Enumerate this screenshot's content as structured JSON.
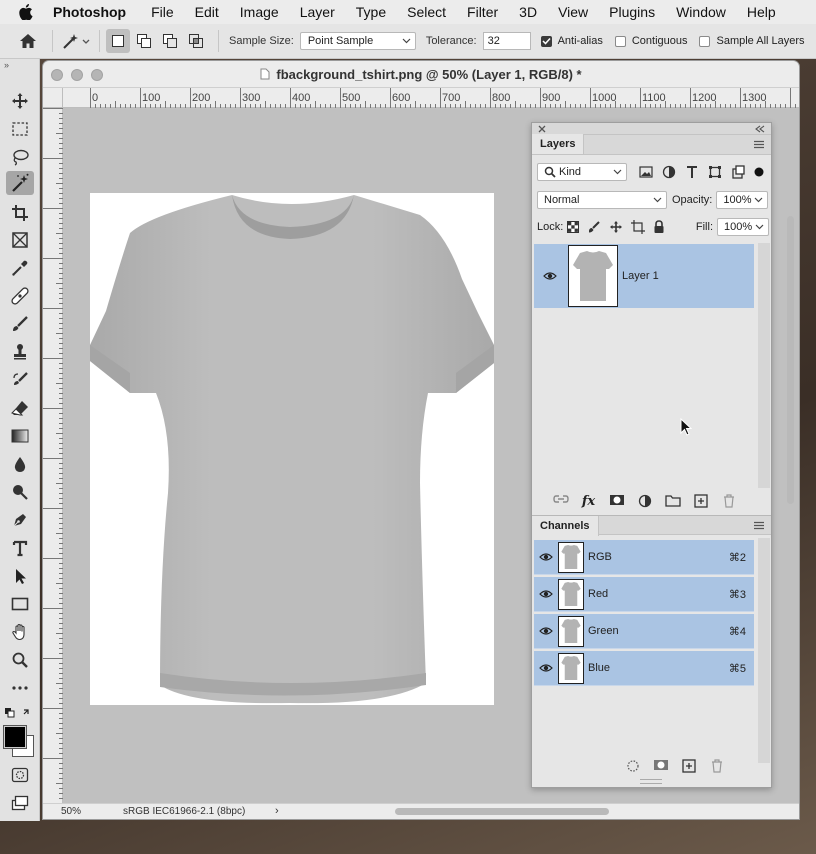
{
  "menubar": {
    "app_name": "Photoshop",
    "items": [
      "File",
      "Edit",
      "Image",
      "Layer",
      "Type",
      "Select",
      "Filter",
      "3D",
      "View",
      "Plugins",
      "Window",
      "Help"
    ]
  },
  "options": {
    "sample_size_label": "Sample Size:",
    "sample_size_value": "Point Sample",
    "tolerance_label": "Tolerance:",
    "tolerance_value": "32",
    "anti_alias_label": "Anti-alias",
    "anti_alias_checked": true,
    "contiguous_label": "Contiguous",
    "contiguous_checked": false,
    "sample_all_layers_label": "Sample All Layers",
    "sample_all_layers_checked": false
  },
  "toolbar": {
    "collapse_glyph": "»",
    "tools": [
      "move",
      "marquee",
      "lasso",
      "magic-wand",
      "crop",
      "frame",
      "eyedropper",
      "healing",
      "brush",
      "stamp",
      "history-brush",
      "eraser",
      "gradient",
      "blur",
      "dodge",
      "pen",
      "type",
      "path-select",
      "rectangle",
      "hand",
      "zoom",
      "more"
    ],
    "active_tool": "magic-wand",
    "foreground_color": "#000000",
    "background_color": "#ffffff"
  },
  "document": {
    "title": "fbackground_tshirt.png @ 50% (Layer 1, RGB/8) *",
    "ruler_labels": [
      "0",
      "100",
      "200",
      "300",
      "400",
      "500",
      "600",
      "700",
      "800",
      "900",
      "1000",
      "1100",
      "1200",
      "1300"
    ],
    "zoom": "50%",
    "color_profile": "sRGB IEC61966-2.1 (8bpc)",
    "status_arrow": "›"
  },
  "layers_panel": {
    "tab_label": "Layers",
    "filter_kind": "Kind",
    "blend_mode": "Normal",
    "opacity_label": "Opacity:",
    "opacity_value": "100%",
    "lock_label": "Lock:",
    "fill_label": "Fill:",
    "fill_value": "100%",
    "layers": [
      {
        "name": "Layer 1",
        "visible": true,
        "selected": true
      }
    ],
    "fx_label": "fx"
  },
  "channels_panel": {
    "tab_label": "Channels",
    "channels": [
      {
        "name": "RGB",
        "shortcut": "⌘2"
      },
      {
        "name": "Red",
        "shortcut": "⌘3"
      },
      {
        "name": "Green",
        "shortcut": "⌘4"
      },
      {
        "name": "Blue",
        "shortcut": "⌘5"
      }
    ]
  },
  "colors": {
    "selection": "#aac4e3",
    "canvas_bg": "#c0c0c0",
    "shirt": "#b9b9b9"
  }
}
